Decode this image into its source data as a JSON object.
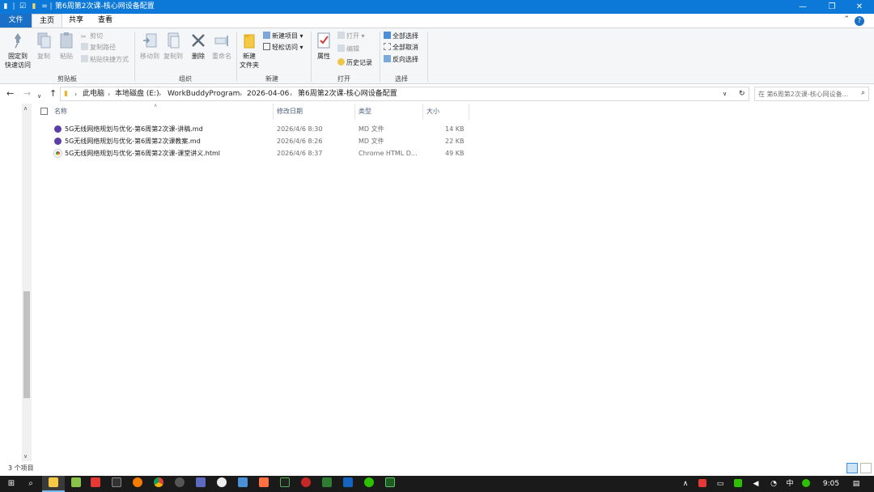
{
  "window": {
    "title": "第6周第2次课-核心网设备配置",
    "buttons": {
      "minimize": "—",
      "maximize": "❐",
      "close": "✕"
    }
  },
  "ribbon_tabs": [
    "文件",
    "主页",
    "共享",
    "查看"
  ],
  "ribbon": {
    "clipboard": {
      "label": "剪贴板",
      "pin": "固定到\n快速访问",
      "copy": "复制",
      "paste": "粘贴",
      "cut": "剪切",
      "copy_path": "复制路径",
      "paste_shortcut": "粘贴快捷方式"
    },
    "organize": {
      "label": "组织",
      "move_to": "移动到",
      "copy_to": "复制到",
      "delete": "删除",
      "rename": "重命名"
    },
    "new": {
      "label": "新建",
      "new_folder": "新建\n文件夹",
      "new_item": "新建项目",
      "easy_access": "轻松访问"
    },
    "open": {
      "label": "打开",
      "properties": "属性",
      "open": "打开",
      "edit": "编辑",
      "history": "历史记录"
    },
    "select": {
      "label": "选择",
      "select_all": "全部选择",
      "select_none": "全部取消",
      "invert": "反向选择"
    }
  },
  "address": {
    "breadcrumbs": [
      "此电脑",
      "本地磁盘 (E:)",
      "WorkBuddyProgram",
      "2026-04-06",
      "第6周第2次课-核心网设备配置"
    ],
    "search_placeholder": "在 第6周第2次课-核心网设备..."
  },
  "columns": {
    "name": "名称",
    "modified": "修改日期",
    "type": "类型",
    "size": "大小"
  },
  "files": [
    {
      "name": "5G无线网络规划与优化-第6周第2次课-讲稿.md",
      "modified": "2026/4/6 8:30",
      "type": "MD 文件",
      "size": "14 KB",
      "icon": "md-file-icon",
      "icon_color": "#5b3fa6"
    },
    {
      "name": "5G无线网络规划与优化-第6周第2次课教案.md",
      "modified": "2026/4/6 8:26",
      "type": "MD 文件",
      "size": "22 KB",
      "icon": "md-file-icon",
      "icon_color": "#5b3fa6"
    },
    {
      "name": "5G无线网络规划与优化-第6周第2次课-课堂讲义.html",
      "modified": "2026/4/6 8:37",
      "type": "Chrome HTML D...",
      "size": "49 KB",
      "icon": "chrome-html-icon",
      "icon_color": "#e8a33a"
    }
  ],
  "status": {
    "item_count": "3 个项目"
  },
  "taskbar": {
    "tray_lang": "中",
    "time": "9:05"
  },
  "colors": {
    "accent": "#0c78d7",
    "file_tab": "#1a6fc6",
    "taskbar": "#1a1a1a"
  }
}
